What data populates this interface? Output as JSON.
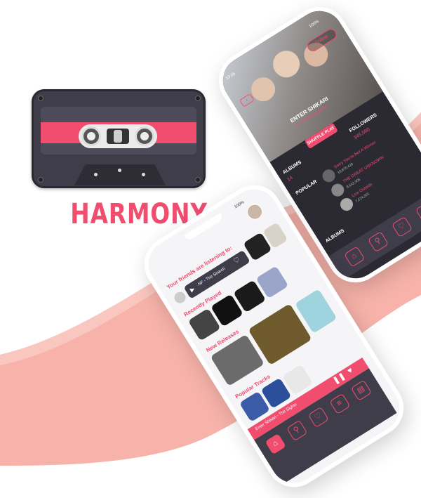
{
  "brand": {
    "name": "HARMONY"
  },
  "colors": {
    "accent": "#f04d6f",
    "dark": "#3f3d4a",
    "swoosh": "#f7b3aa"
  },
  "left_phone": {
    "status": {
      "time": "",
      "battery": "100%"
    },
    "friends_title": "Your friends are listening to:",
    "now_playing": "NF - The Search",
    "recently_played": "Recently Played",
    "new_releases": "New Releases",
    "popular_tracks": "Popular Tracks",
    "mini_player": "Enter Shikari - The Sights",
    "nav_icons": [
      "home-icon",
      "search-icon",
      "heart-icon",
      "list-icon",
      "radio-icon"
    ]
  },
  "right_phone": {
    "status": {
      "time": "13:05",
      "battery": "100%"
    },
    "follow": "Follow",
    "artist": "ENTER SHIKARI",
    "subtitle": "UK Drumming Band",
    "shuffle": "SHUFFLE PLAY",
    "followers_label": "FOLLOWERS",
    "followers_value": "345,560",
    "albums_label": "ALBUMS",
    "albums_value": "14",
    "popular_label": "POPULAR",
    "tracks": [
      {
        "title": "Sorry You're Not A Winner",
        "plays": "18,870,429"
      },
      {
        "title": "THE GREAT UNKNOWN",
        "plays": "8,542,305"
      },
      {
        "title": "Live Outside",
        "plays": "7,214,201"
      }
    ],
    "albums_footer": "ALBUMS",
    "nav_icons": [
      "home-icon",
      "search-icon",
      "heart-icon",
      "list-icon"
    ]
  }
}
